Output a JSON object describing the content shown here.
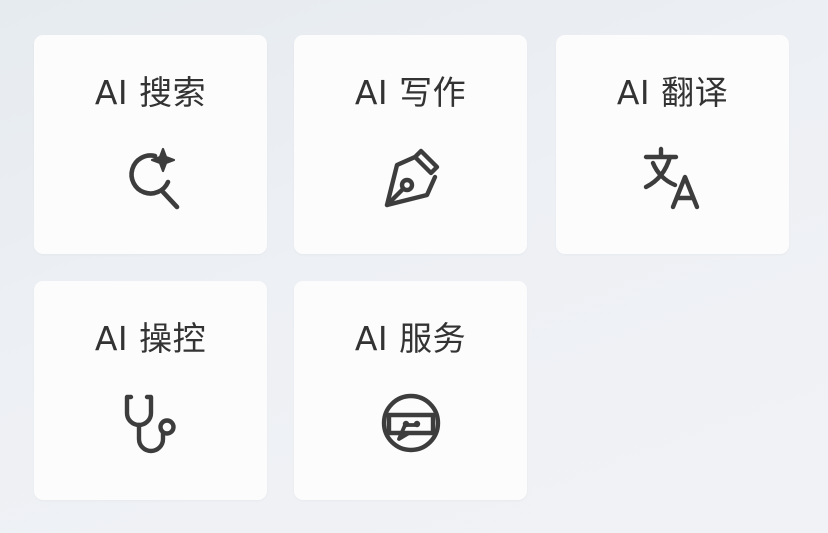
{
  "tiles": [
    {
      "label": "AI 搜索",
      "icon": "sparkle-search-icon"
    },
    {
      "label": "AI 写作",
      "icon": "pen-nib-icon"
    },
    {
      "label": "AI 翻译",
      "icon": "translate-icon"
    },
    {
      "label": "AI 操控",
      "icon": "stethoscope-icon"
    },
    {
      "label": "AI 服务",
      "icon": "chat-bot-icon"
    }
  ],
  "colors": {
    "tile_background": "#fcfcfd",
    "text": "#333333",
    "icon": "#3d3d3d"
  }
}
